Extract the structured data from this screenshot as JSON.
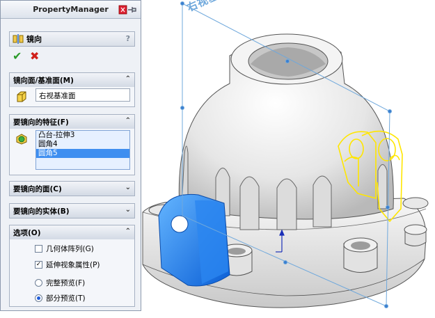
{
  "property_manager": {
    "header_title": "PropertyManager",
    "feature_title": "镜向",
    "help": "?",
    "ok_symbol": "✔",
    "cancel_symbol": "✖"
  },
  "mirror_face_group": {
    "title": "镜向面/基准面(M)",
    "chevron": "⌃",
    "value": "右视基准面"
  },
  "features_group": {
    "title": "要镜向的特征(F)",
    "chevron": "⌃",
    "items": [
      "凸台-拉伸3",
      "圆角4",
      "圆角5"
    ],
    "selected_index": 2
  },
  "faces_group": {
    "title": "要镜向的面(C)",
    "chevron": "⌄"
  },
  "bodies_group": {
    "title": "要镜向的实体(B)",
    "chevron": "⌄"
  },
  "options_group": {
    "title": "选项(O)",
    "chevron": "⌃",
    "geometry_pattern": {
      "label": "几何体阵列(G)",
      "checked": false
    },
    "propagate_visual": {
      "label": "延伸视象属性(P)",
      "checked": true,
      "mark": "✓"
    },
    "full_preview": {
      "label": "完整预览(F)",
      "selected": false
    },
    "partial_preview": {
      "label": "部分预览(T)",
      "selected": true
    }
  },
  "viewport": {
    "plane_label": "右视基准面",
    "colors": {
      "plane": "#6fa8dc",
      "preview": "#ffe600",
      "selected": "#1e7cf0",
      "part": "#f2f2f2"
    }
  }
}
